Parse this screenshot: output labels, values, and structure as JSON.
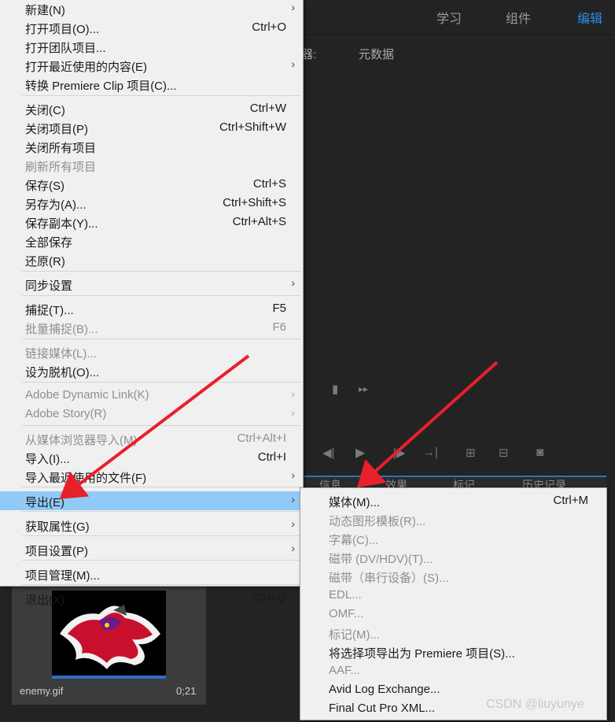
{
  "workspace": {
    "tabs": [
      "学习",
      "组件",
      "编辑"
    ],
    "active_tab": "编辑"
  },
  "metadata_panel": {
    "label_prefix": "器:",
    "label": "元数据"
  },
  "lower_tabs": [
    "信息",
    "效果",
    "标记",
    "历史记录"
  ],
  "project_item": {
    "name": "enemy.gif",
    "duration": "0;21"
  },
  "watermark": "CSDN @liuyunye",
  "main_menu": {
    "items": [
      {
        "label": "新建(N)",
        "shortcut": "",
        "submenu": true,
        "disabled": false
      },
      {
        "label": "打开项目(O)...",
        "shortcut": "Ctrl+O",
        "submenu": false,
        "disabled": false
      },
      {
        "label": "打开团队项目...",
        "shortcut": "",
        "submenu": false,
        "disabled": false
      },
      {
        "label": "打开最近使用的内容(E)",
        "shortcut": "",
        "submenu": true,
        "disabled": false
      },
      {
        "label": "转换 Premiere Clip 项目(C)...",
        "shortcut": "",
        "submenu": false,
        "disabled": false
      },
      {
        "label": "关闭(C)",
        "shortcut": "Ctrl+W",
        "submenu": false,
        "disabled": false
      },
      {
        "label": "关闭项目(P)",
        "shortcut": "Ctrl+Shift+W",
        "submenu": false,
        "disabled": false
      },
      {
        "label": "关闭所有项目",
        "shortcut": "",
        "submenu": false,
        "disabled": false
      },
      {
        "label": "刷新所有项目",
        "shortcut": "",
        "submenu": false,
        "disabled": true
      },
      {
        "label": "保存(S)",
        "shortcut": "Ctrl+S",
        "submenu": false,
        "disabled": false
      },
      {
        "label": "另存为(A)...",
        "shortcut": "Ctrl+Shift+S",
        "submenu": false,
        "disabled": false
      },
      {
        "label": "保存副本(Y)...",
        "shortcut": "Ctrl+Alt+S",
        "submenu": false,
        "disabled": false
      },
      {
        "label": "全部保存",
        "shortcut": "",
        "submenu": false,
        "disabled": false
      },
      {
        "label": "还原(R)",
        "shortcut": "",
        "submenu": false,
        "disabled": false
      },
      {
        "label": "同步设置",
        "shortcut": "",
        "submenu": true,
        "disabled": false
      },
      {
        "label": "捕捉(T)...",
        "shortcut": "F5",
        "submenu": false,
        "disabled": false
      },
      {
        "label": "批量捕捉(B)...",
        "shortcut": "F6",
        "submenu": false,
        "disabled": true
      },
      {
        "label": "链接媒体(L)...",
        "shortcut": "",
        "submenu": false,
        "disabled": true
      },
      {
        "label": "设为脱机(O)...",
        "shortcut": "",
        "submenu": false,
        "disabled": false
      },
      {
        "label": "Adobe Dynamic Link(K)",
        "shortcut": "",
        "submenu": true,
        "disabled": true
      },
      {
        "label": "Adobe Story(R)",
        "shortcut": "",
        "submenu": true,
        "disabled": true
      },
      {
        "label": "从媒体浏览器导入(M)",
        "shortcut": "Ctrl+Alt+I",
        "submenu": false,
        "disabled": true
      },
      {
        "label": "导入(I)...",
        "shortcut": "Ctrl+I",
        "submenu": false,
        "disabled": false
      },
      {
        "label": "导入最近使用的文件(F)",
        "shortcut": "",
        "submenu": true,
        "disabled": false
      },
      {
        "label": "导出(E)",
        "shortcut": "",
        "submenu": true,
        "disabled": false,
        "highlighted": true
      },
      {
        "label": "获取属性(G)",
        "shortcut": "",
        "submenu": true,
        "disabled": false
      },
      {
        "label": "项目设置(P)",
        "shortcut": "",
        "submenu": true,
        "disabled": false
      },
      {
        "label": "项目管理(M)...",
        "shortcut": "",
        "submenu": false,
        "disabled": false
      },
      {
        "label": "退出(X)",
        "shortcut": "Ctrl+Q",
        "submenu": false,
        "disabled": false
      }
    ]
  },
  "export_submenu": {
    "items": [
      {
        "label": "媒体(M)...",
        "shortcut": "Ctrl+M",
        "disabled": false
      },
      {
        "label": "动态图形模板(R)...",
        "shortcut": "",
        "disabled": true
      },
      {
        "label": "字幕(C)...",
        "shortcut": "",
        "disabled": true
      },
      {
        "label": "磁带 (DV/HDV)(T)...",
        "shortcut": "",
        "disabled": true
      },
      {
        "label": "磁带（串行设备）(S)...",
        "shortcut": "",
        "disabled": true
      },
      {
        "label": "EDL...",
        "shortcut": "",
        "disabled": true
      },
      {
        "label": "OMF...",
        "shortcut": "",
        "disabled": true
      },
      {
        "label": "标记(M)...",
        "shortcut": "",
        "disabled": true
      },
      {
        "label": "将选择项导出为 Premiere 项目(S)...",
        "shortcut": "",
        "disabled": false
      },
      {
        "label": "AAF...",
        "shortcut": "",
        "disabled": true
      },
      {
        "label": "Avid Log Exchange...",
        "shortcut": "",
        "disabled": false
      },
      {
        "label": "Final Cut Pro XML...",
        "shortcut": "",
        "disabled": false
      }
    ]
  },
  "colors": {
    "accent": "#2d8ceb",
    "highlight": "#91c9f7",
    "annotation_arrow": "#e8202a"
  }
}
